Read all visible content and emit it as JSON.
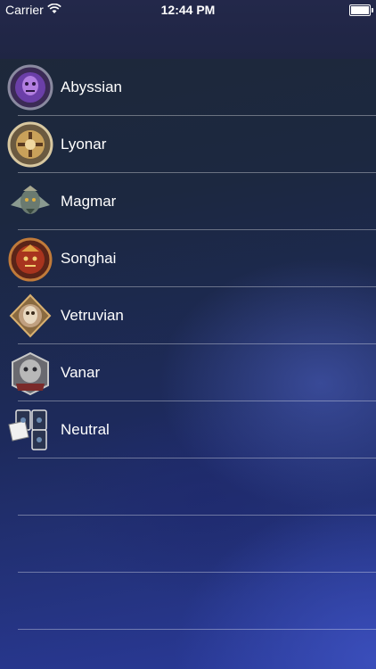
{
  "status": {
    "carrier": "Carrier",
    "time": "12:44 PM"
  },
  "factions": [
    {
      "label": "Abyssian",
      "icon": "abyssian-crest-icon",
      "color": "#7a4fb0"
    },
    {
      "label": "Lyonar",
      "icon": "lyonar-crest-icon",
      "color": "#c9a15a"
    },
    {
      "label": "Magmar",
      "icon": "magmar-crest-icon",
      "color": "#7c8c80"
    },
    {
      "label": "Songhai",
      "icon": "songhai-crest-icon",
      "color": "#b0402a"
    },
    {
      "label": "Vetruvian",
      "icon": "vetruvian-crest-icon",
      "color": "#c08a45"
    },
    {
      "label": "Vanar",
      "icon": "vanar-crest-icon",
      "color": "#b8b8b8"
    },
    {
      "label": "Neutral",
      "icon": "neutral-cards-icon",
      "color": "#3a4a6a"
    }
  ]
}
